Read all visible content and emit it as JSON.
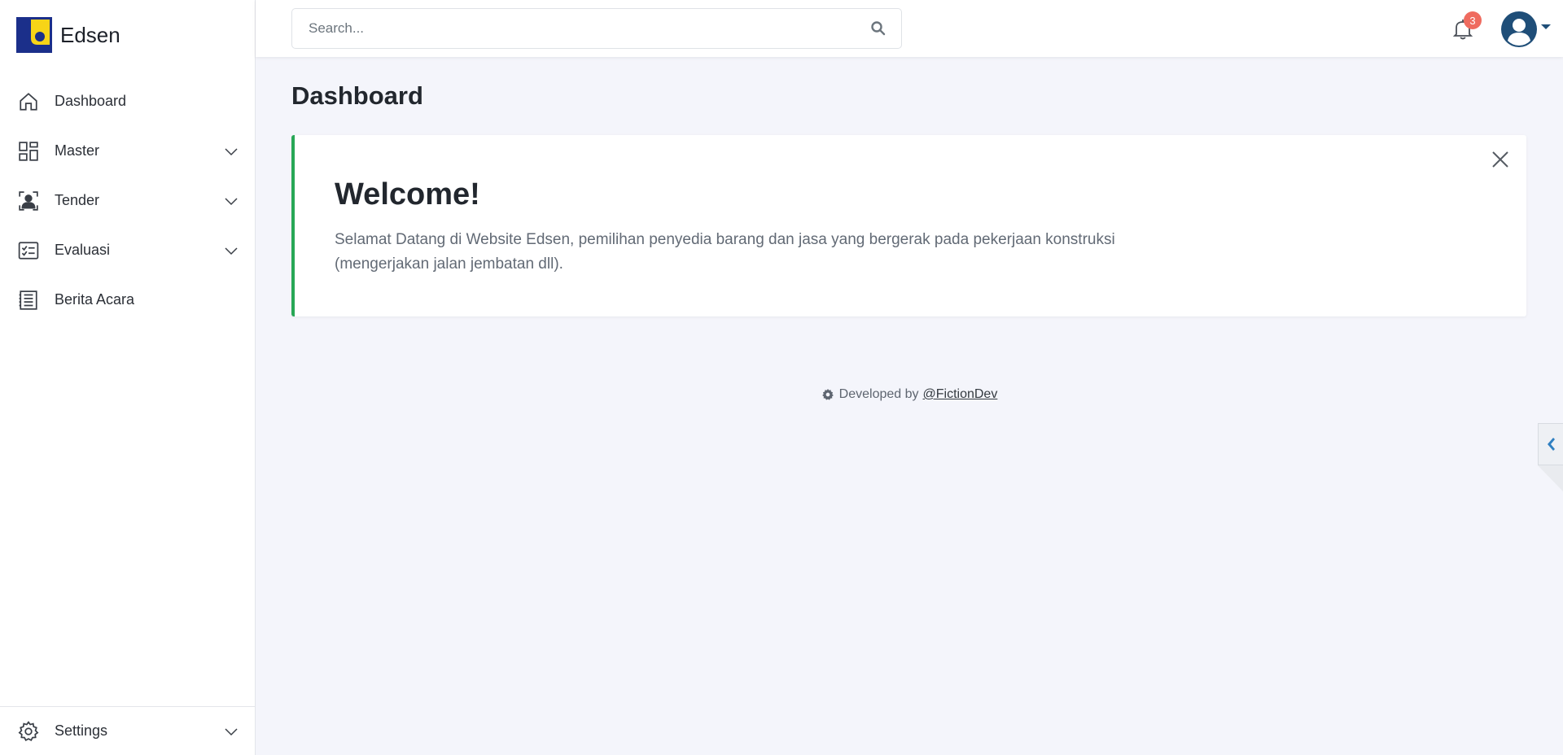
{
  "brand": {
    "name": "Edsen",
    "logo_colors": {
      "blue": "#1b2f8a",
      "yellow": "#f7d417"
    }
  },
  "sidebar": {
    "items": [
      {
        "label": "Dashboard",
        "icon": "home-icon",
        "has_chevron": false
      },
      {
        "label": "Master",
        "icon": "grid-icon",
        "has_chevron": true
      },
      {
        "label": "Tender",
        "icon": "person-frame-icon",
        "has_chevron": true
      },
      {
        "label": "Evaluasi",
        "icon": "checklist-icon",
        "has_chevron": true
      },
      {
        "label": "Berita Acara",
        "icon": "document-icon",
        "has_chevron": false
      }
    ],
    "settings": {
      "label": "Settings",
      "icon": "gear-icon",
      "has_chevron": true
    }
  },
  "topbar": {
    "search": {
      "placeholder": "Search...",
      "value": "",
      "icon": "search-icon"
    },
    "notifications": {
      "count": "3",
      "icon": "bell-icon"
    },
    "user": {
      "icon": "user-avatar-icon"
    }
  },
  "main": {
    "title": "Dashboard",
    "welcome": {
      "title": "Welcome!",
      "text": "Selamat Datang di Website Edsen, pemilihan penyedia barang dan jasa yang bergerak pada pekerjaan konstruksi (mengerjakan jalan jembatan dll).",
      "close_icon": "close-icon"
    },
    "footer": {
      "prefix": "Developed by",
      "link": "@FictionDev",
      "icon": "gear-icon"
    }
  },
  "colors": {
    "accent_green": "#28a756",
    "badge_red": "#ef6b5f",
    "avatar_blue": "#1f4e78",
    "toggle_blue": "#2f7fc1"
  }
}
